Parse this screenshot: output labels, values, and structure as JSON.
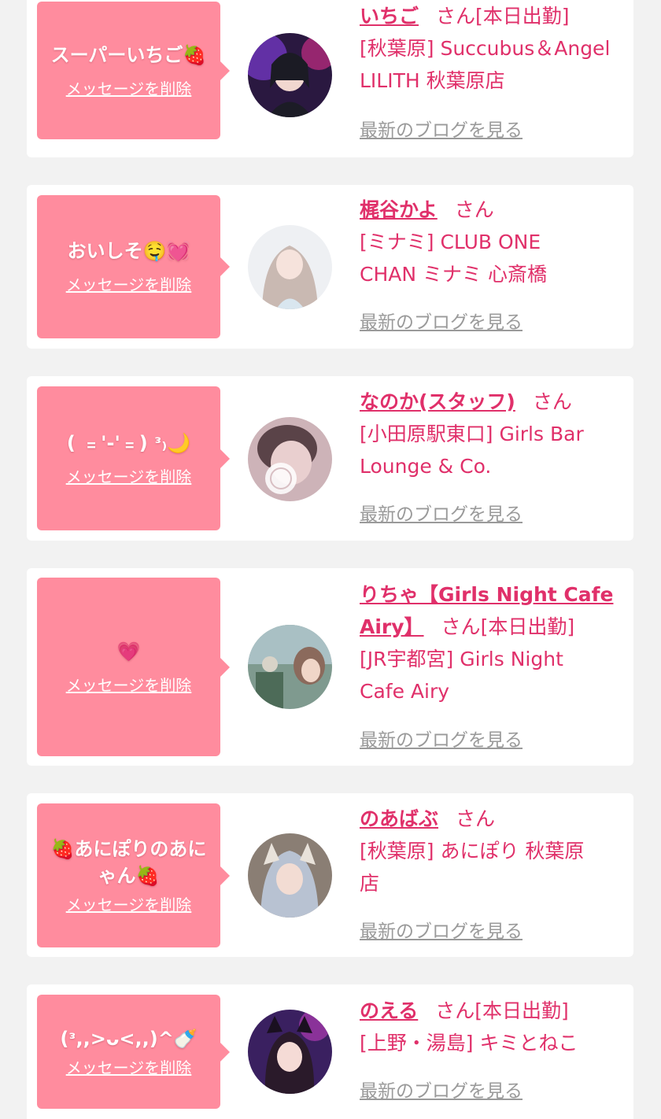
{
  "colors": {
    "page_bg": "#f2f2f2",
    "card_bg": "#ffffff",
    "bubble_bg": "#ff8c9e",
    "accent_text": "#e0306a",
    "blog_link": "#9a9a9a"
  },
  "common": {
    "delete_label": "メッセージを削除",
    "san_label": "さん",
    "blog_label": "最新のブログを見る",
    "on_duty_label": "[本日出勤]"
  },
  "items": [
    {
      "message": "スーパーいちご🍓",
      "name": "いちご",
      "on_duty": true,
      "shop_line1": "[秋葉原] Succubus＆Angel",
      "shop_line2": "LILITH 秋葉原店",
      "avatar_icon": "profile-photo"
    },
    {
      "message": "おいしそ🤤💓",
      "name": "梶谷かよ",
      "on_duty": false,
      "shop_line1": "[ミナミ] CLUB ONE",
      "shop_line2": "CHAN ミナミ 心斎橋",
      "avatar_icon": "profile-photo"
    },
    {
      "message": "( ﹦'-'﹦) ᵌ₎🌙",
      "name": "なのか(スタッフ)",
      "on_duty": false,
      "shop_line1": "[小田原駅東口] Girls Bar",
      "shop_line2": "Lounge & Co.",
      "avatar_icon": "profile-photo"
    },
    {
      "message": "💗",
      "name_line1": "りちゃ【Girls Night Cafe",
      "name_line2": "Airy】",
      "on_duty": true,
      "shop_line1": "[JR宇都宮] Girls Night",
      "shop_line2": "Cafe Airy",
      "avatar_icon": "profile-photo"
    },
    {
      "message": "🍓あにぽりのあにゃん🍓",
      "name": "のあばぶ",
      "on_duty": false,
      "shop_line1": "[秋葉原] あにぽり 秋葉原",
      "shop_line2": "店",
      "avatar_icon": "profile-photo"
    },
    {
      "message": "(ᵌ,,>ᴗ<,,)^🍼",
      "name": "のえる",
      "on_duty": true,
      "shop_line1": "[上野・湯島] キミとねこ",
      "avatar_icon": "profile-photo"
    }
  ]
}
